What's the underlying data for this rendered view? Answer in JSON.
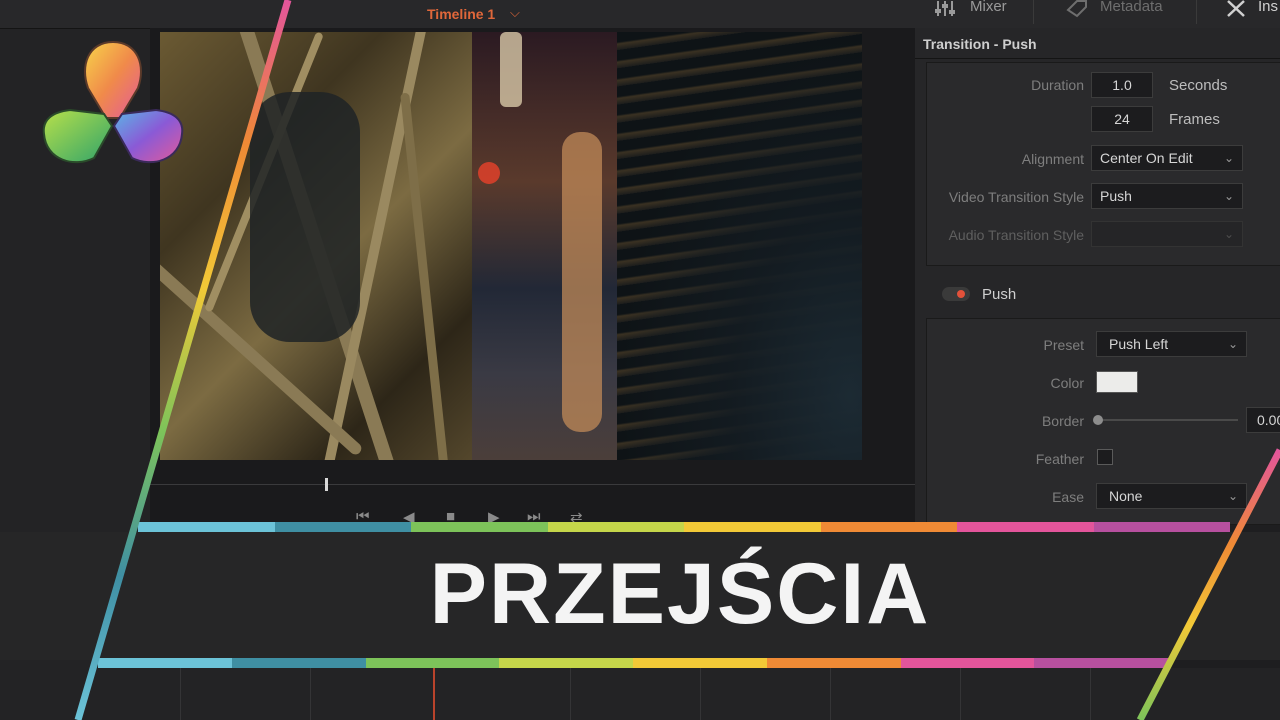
{
  "topbar": {
    "timeline_title": "Timeline 1",
    "timeline_chevron": "⌵",
    "mixer_label": "Mixer",
    "metadata_label": "Metadata",
    "inspector_label_partial": "Ins"
  },
  "transport": {
    "skip_back": "⏮",
    "step_back": "◀",
    "stop": "■",
    "play": "▶",
    "skip_forward": "⏭",
    "loop": "⇄"
  },
  "inspector": {
    "title": "Transition - Push",
    "duration": {
      "label": "Duration",
      "seconds_value": "1.0",
      "seconds_unit": "Seconds",
      "frames_value": "24",
      "frames_unit": "Frames"
    },
    "alignment": {
      "label": "Alignment",
      "value": "Center On Edit"
    },
    "video_style": {
      "label": "Video Transition Style",
      "value": "Push"
    },
    "audio_style": {
      "label": "Audio Transition Style",
      "value": ""
    },
    "push": {
      "title": "Push",
      "preset": {
        "label": "Preset",
        "value": "Push Left"
      },
      "color": {
        "label": "Color",
        "swatch": "#ececea"
      },
      "border": {
        "label": "Border",
        "value": "0.00",
        "level": 0
      },
      "feather": {
        "label": "Feather",
        "checked": false
      },
      "ease": {
        "label": "Ease",
        "value": "None"
      }
    }
  },
  "banner": {
    "title": "PRZEJŚCIA",
    "stripe_colors": [
      "#6cc3d8",
      "#3f8fa3",
      "#7dc35a",
      "#c5d64a",
      "#f2c937",
      "#ef8a35",
      "#e3559b",
      "#b7509f"
    ]
  },
  "colors": {
    "accent_orange": "#e0673a",
    "toggle_red": "#e2513a",
    "playhead": "#b9432b"
  }
}
